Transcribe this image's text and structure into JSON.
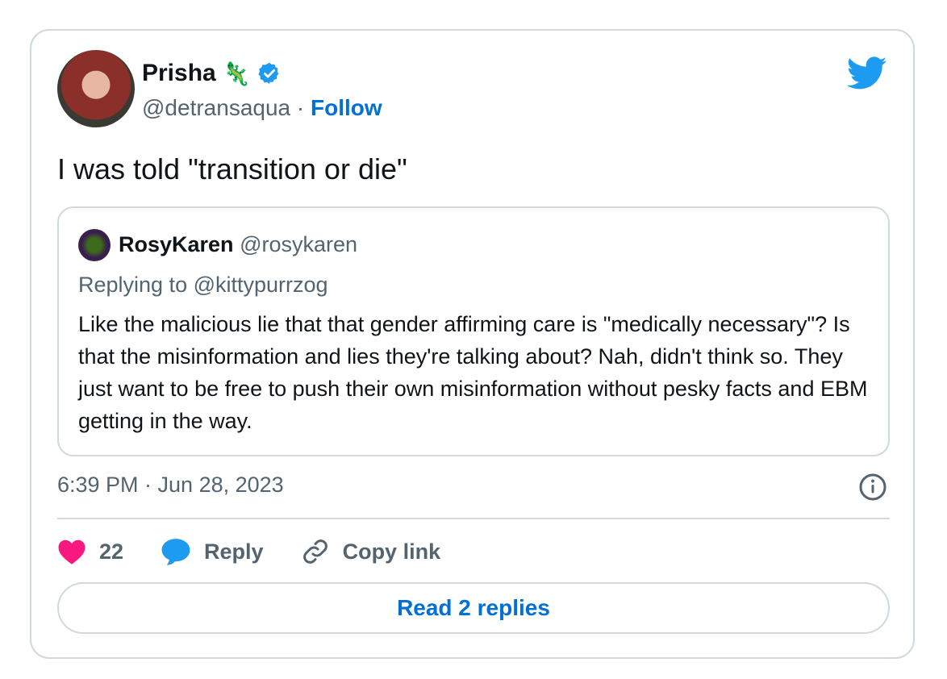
{
  "tweet": {
    "author_name": "Prisha",
    "name_emoji": "🦎",
    "verified_icon": "verified-badge-icon",
    "handle": "@detransaqua",
    "separator": " · ",
    "follow_label": "Follow",
    "text": "I was told \"transition or die\"",
    "timestamp": "6:39 PM · Jun 28, 2023"
  },
  "quote": {
    "author_name": "RosyKaren",
    "handle": "@rosykaren",
    "replying_to": "Replying to @kittypurrzog",
    "body": "Like the malicious lie that that gender affirming care is \"medically necessary\"? Is that the misinformation and lies they're talking about? Nah, didn't think so. They just want to be free to push their own misinformation without pesky facts and EBM getting in the way."
  },
  "actions": {
    "like_count": "22",
    "reply_label": "Reply",
    "copy_label": "Copy link"
  },
  "read_replies_label": "Read 2 replies",
  "colors": {
    "accent": "#006fd6",
    "twitter_blue": "#1d9bf0",
    "heart": "#f91880",
    "muted": "#536471",
    "border": "#cfd9de"
  }
}
